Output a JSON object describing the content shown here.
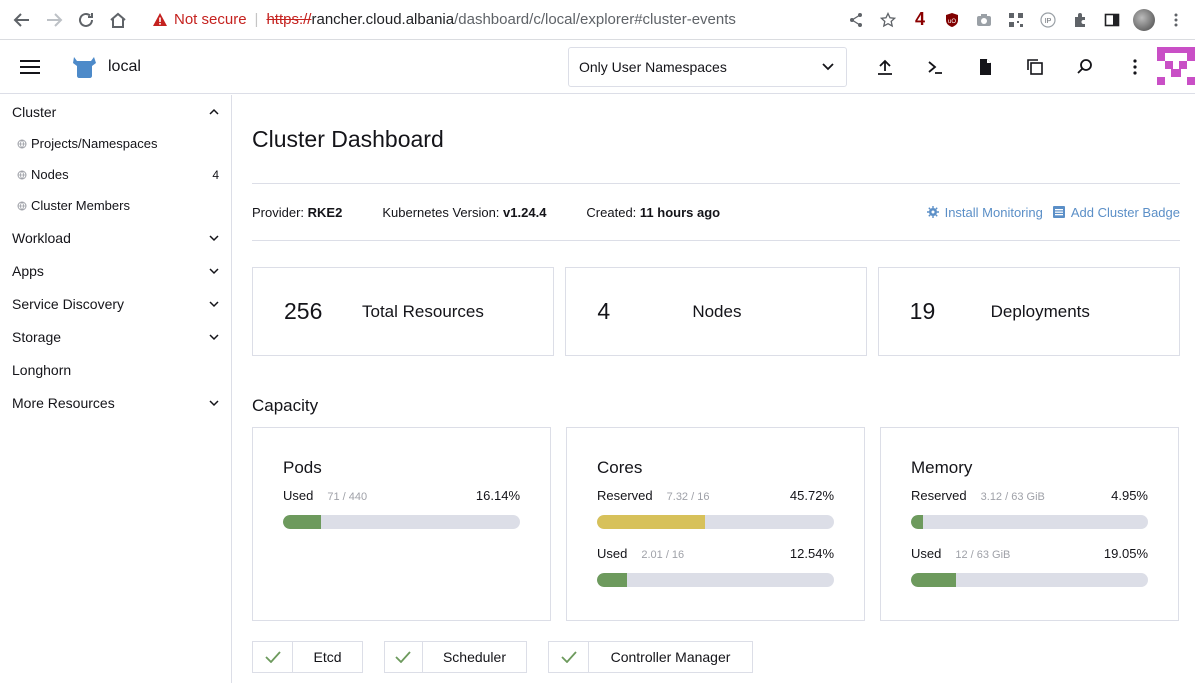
{
  "browser": {
    "security_label": "Not secure",
    "url_scheme": "https://",
    "url_host": "rancher.cloud.albania",
    "url_path": "/dashboard/c/local/explorer#cluster-events",
    "ext_badge": "4"
  },
  "header": {
    "cluster_name": "local",
    "namespace_filter": "Only User Namespaces"
  },
  "sidebar": {
    "groups": [
      {
        "label": "Cluster",
        "expanded": true
      },
      {
        "label": "Workload"
      },
      {
        "label": "Apps"
      },
      {
        "label": "Service Discovery"
      },
      {
        "label": "Storage"
      },
      {
        "label": "Longhorn"
      },
      {
        "label": "More Resources"
      }
    ],
    "cluster_items": [
      {
        "label": "Projects/Namespaces",
        "count": ""
      },
      {
        "label": "Nodes",
        "count": "4"
      },
      {
        "label": "Cluster Members",
        "count": ""
      }
    ]
  },
  "main": {
    "title": "Cluster Dashboard",
    "meta": {
      "provider_label": "Provider:",
      "provider_value": "RKE2",
      "k8s_label": "Kubernetes Version:",
      "k8s_value": "v1.24.4",
      "created_label": "Created:",
      "created_value": "11 hours ago"
    },
    "actions": {
      "install_monitoring": "Install Monitoring",
      "add_badge": "Add Cluster Badge"
    },
    "cards": [
      {
        "value": "256",
        "label": "Total Resources"
      },
      {
        "value": "4",
        "label": "Nodes"
      },
      {
        "value": "19",
        "label": "Deployments"
      }
    ],
    "capacity_title": "Capacity",
    "capacity": [
      {
        "title": "Pods",
        "meters": [
          {
            "label": "Used",
            "sub": "71 / 440",
            "pct": "16.14%",
            "fraction": 0.1614,
            "color": "#6d9a5d"
          }
        ]
      },
      {
        "title": "Cores",
        "meters": [
          {
            "label": "Reserved",
            "sub": "7.32 / 16",
            "pct": "45.72%",
            "fraction": 0.4572,
            "color": "#d7c15a"
          },
          {
            "label": "Used",
            "sub": "2.01 / 16",
            "pct": "12.54%",
            "fraction": 0.1254,
            "color": "#6d9a5d"
          }
        ]
      },
      {
        "title": "Memory",
        "meters": [
          {
            "label": "Reserved",
            "sub": "3.12 / 63 GiB",
            "pct": "4.95%",
            "fraction": 0.0495,
            "color": "#6d9a5d"
          },
          {
            "label": "Used",
            "sub": "12 / 63 GiB",
            "pct": "19.05%",
            "fraction": 0.1905,
            "color": "#6d9a5d"
          }
        ]
      }
    ],
    "components": [
      {
        "label": "Etcd"
      },
      {
        "label": "Scheduler"
      },
      {
        "label": "Controller Manager"
      }
    ]
  },
  "colors": {
    "link": "#5b8fc7",
    "healthy": "#6d9a5d",
    "warning_bar": "#d7c15a"
  }
}
